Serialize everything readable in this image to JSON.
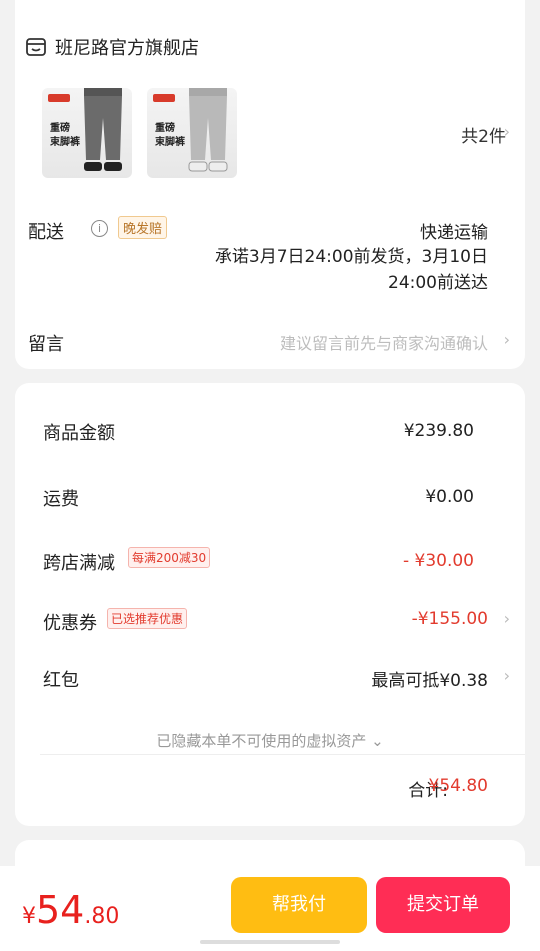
{
  "store": {
    "name": "班尼路官方旗舰店",
    "icon": "shop-icon"
  },
  "products": {
    "items": [
      {
        "brand_color": "#d83b2b",
        "caption": "重磅\n束脚裤",
        "pants_color": "#6b6b6b"
      },
      {
        "brand_color": "#d83b2b",
        "caption": "重磅\n束脚裤",
        "pants_color": "#b9b9b9"
      }
    ],
    "count_label": "共2件"
  },
  "shipping": {
    "label": "配送",
    "tag": "晚发赔",
    "method": "快递运输",
    "promise": "承诺3月7日24:00前发货，3月10日24:00前送达"
  },
  "message": {
    "label": "留言",
    "placeholder": "建议留言前先与商家沟通确认"
  },
  "amounts": {
    "goods_label": "商品金额",
    "goods_value": "¥239.80",
    "freight_label": "运费",
    "freight_value": "¥0.00",
    "cross_label": "跨店满减",
    "cross_badge": "每满200减30",
    "cross_value": "- ¥30.00",
    "coupon_label": "优惠券",
    "coupon_badge": "已选推荐优惠",
    "coupon_value": "-¥155.00",
    "redpacket_label": "红包",
    "redpacket_value": "最高可抵¥0.38",
    "hidden_note": "已隐藏本单不可使用的虚拟资产",
    "total_label": "合计:",
    "total_value": "¥54.80"
  },
  "bottom": {
    "price_symbol": "¥",
    "price_int": "54",
    "price_dec": ".80",
    "help_button": "帮我付",
    "pay_button": "提交订单"
  },
  "colors": {
    "accent_red": "#e23b2e",
    "help_yellow": "#ffbd12",
    "pay_pink": "#ff2d55"
  }
}
